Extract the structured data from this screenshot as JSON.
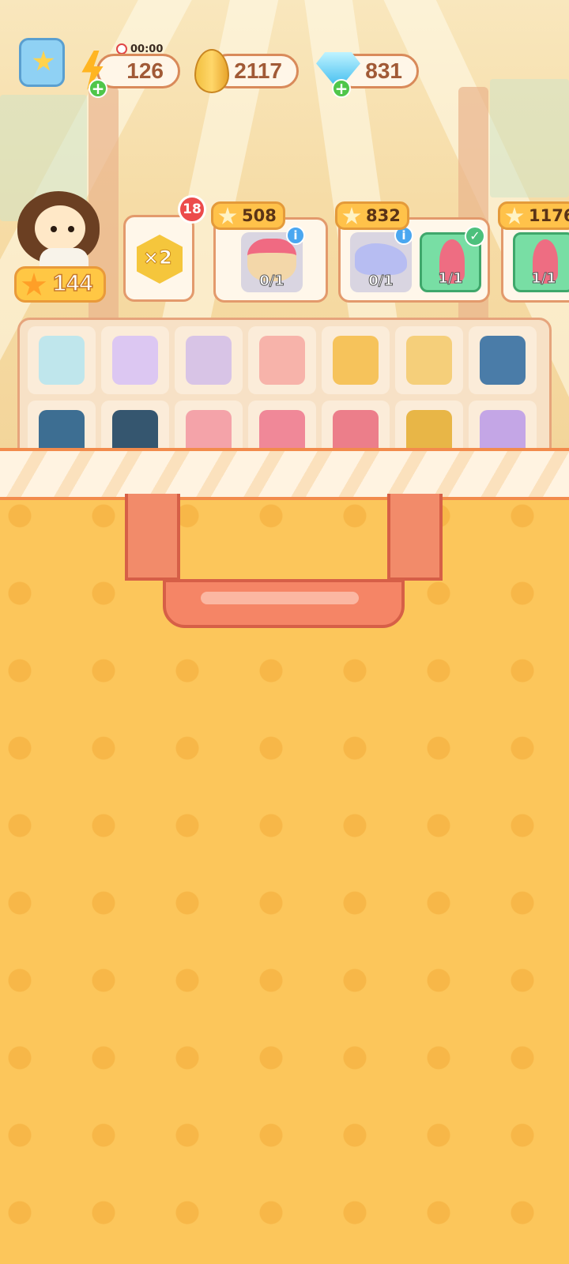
{
  "hud": {
    "energy": {
      "value": "126",
      "timer": "00:00"
    },
    "seeds": {
      "value": "2117"
    },
    "gems": {
      "value": "831"
    }
  },
  "player": {
    "stars": "144"
  },
  "booster": {
    "label": "×2",
    "badge": "18"
  },
  "orders": [
    {
      "cost": "508",
      "items": [
        {
          "progress": "0/1",
          "icon": "cake-icon"
        }
      ]
    },
    {
      "cost": "832",
      "items": [
        {
          "progress": "0/1",
          "icon": "shoes-icon"
        },
        {
          "progress": "1/1",
          "icon": "hair-dryer-icon"
        }
      ]
    },
    {
      "cost": "1176",
      "items": [
        {
          "progress": "1/1",
          "icon": "hair-dryer-icon"
        }
      ]
    }
  ],
  "board_items": [
    "bird-mobile-icon",
    "dress-display-icon",
    "mannequin-icon",
    "pink-dress-icon",
    "shopping-cart-full-icon",
    "shopping-cart-icon",
    "cleaning-cart-icon",
    "treadmill-icon",
    "toolbox-icon",
    "mirror-icon",
    "display-case-icon",
    "cosmetics-icon",
    "bag-handle-icon",
    "cart-boxes-icon"
  ],
  "colors": {
    "bag": "#fcc65b",
    "accent": "#f28b4c",
    "gem": "#35b8ee",
    "badge": "#ec4b4b"
  }
}
